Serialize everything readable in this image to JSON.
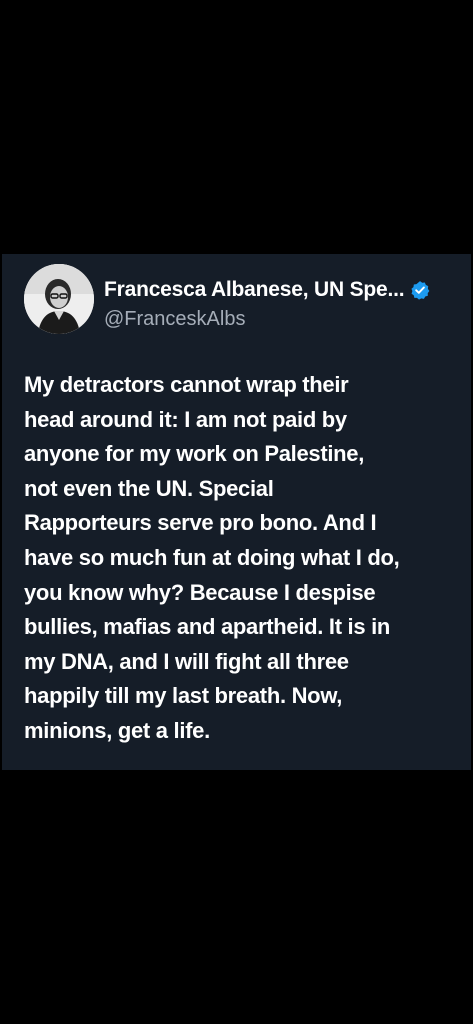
{
  "tweet": {
    "author": {
      "display_name": "Francesca Albanese, UN Spe...",
      "handle": "@FranceskAlbs",
      "verified": true,
      "verified_color": "#1d9bf0",
      "avatar_icon": "profile-photo"
    },
    "text_lines": [
      "My detractors cannot wrap their",
      "head around it: I am not paid by",
      "anyone for my work on Palestine,",
      "not even the UN. Special",
      "Rapporteurs serve pro bono. And I",
      "have so much fun at doing what I do,",
      "you know why? Because I despise",
      "bullies, mafias and apartheid. It is in",
      "my DNA, and I will fight all three",
      "happily till my last breath. Now,",
      "minions, get a life."
    ]
  },
  "colors": {
    "background": "#000000",
    "card_background": "#151d28",
    "text_primary": "#ffffff",
    "text_secondary": "#a5adb8"
  }
}
